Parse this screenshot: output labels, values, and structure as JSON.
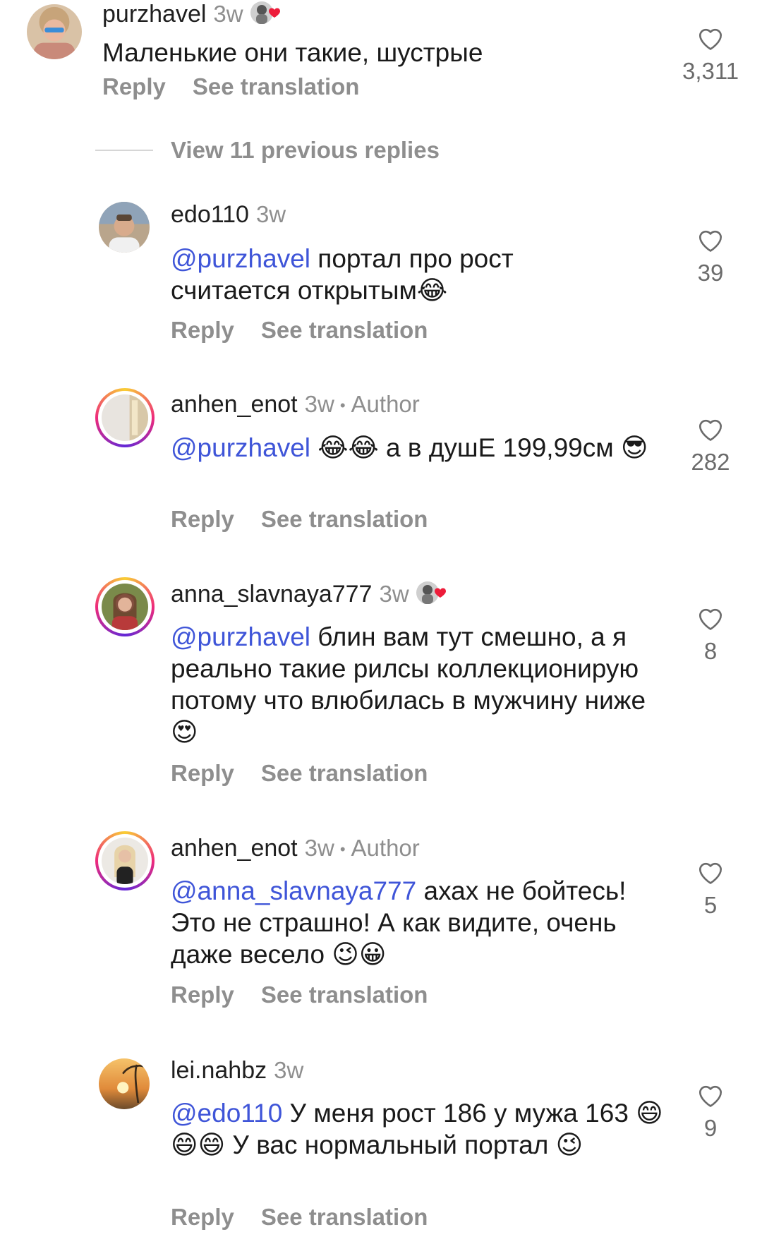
{
  "labels": {
    "reply": "Reply",
    "see_translation": "See translation",
    "author": "Author",
    "view_previous": "View 11 previous replies"
  },
  "comments": [
    {
      "username": "purzhavel",
      "time": "3w",
      "mention": "",
      "text": "Маленькие они такие, шустрые",
      "likes": "3,311"
    },
    {
      "username": "edo110",
      "time": "3w",
      "mention": "@purzhavel",
      "text": " портал про рост считается открытым😂",
      "likes": "39"
    },
    {
      "username": "anhen_enot",
      "time": "3w",
      "mention": "@purzhavel",
      "text": " 😂😂 а в душЕ 199,99см 😎",
      "likes": "282"
    },
    {
      "username": "anna_slavnaya777",
      "time": "3w",
      "mention": "@purzhavel",
      "text": " блин вам тут смешно, а я реально такие рилсы коллекционирую потому что влюбилась в мужчину ниже 😍",
      "likes": "8"
    },
    {
      "username": "anhen_enot",
      "time": "3w",
      "mention": "@anna_slavnaya777",
      "text": " ахах не бойтесь! Это не страшно! А как видите, очень даже весело 😉😀",
      "likes": "5"
    },
    {
      "username": "lei.nahbz",
      "time": "3w",
      "mention": "@edo110",
      "text": " У меня рост 186 у мужа 163 😄😄😄 У вас нормальный портал 😉",
      "likes": "9"
    }
  ],
  "colors": {
    "mention": "#3f55d8",
    "secondary": "#8e8e8e",
    "like_icon": "#6b6b6b",
    "author_heart": "#ed1c3a"
  }
}
